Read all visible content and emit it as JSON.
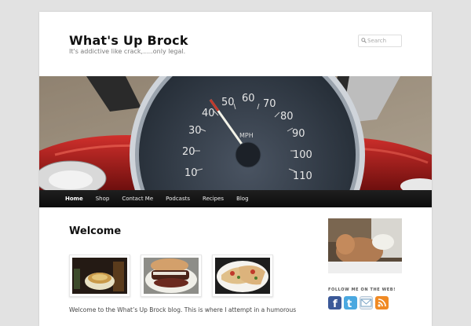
{
  "header": {
    "site_title": "What's Up Brock",
    "site_description": "It's addictive like crack,.....only legal."
  },
  "search": {
    "placeholder": "Search",
    "icon": "search-icon"
  },
  "banner": {
    "speedometer_numbers": [
      "10",
      "20",
      "30",
      "40",
      "50",
      "60",
      "70",
      "80",
      "90",
      "100",
      "110"
    ],
    "unit": "MPH"
  },
  "nav": {
    "items": [
      {
        "label": "Home",
        "active": true
      },
      {
        "label": "Shop"
      },
      {
        "label": "Contact Me"
      },
      {
        "label": "Podcasts"
      },
      {
        "label": "Recipes"
      },
      {
        "label": "Blog"
      }
    ]
  },
  "post": {
    "title": "Welcome",
    "intro": "Welcome to the What’s Up Brock blog. This is where I attempt in a humorous"
  },
  "sidebar": {
    "follow_title": "FOLLOW ME ON THE WEB!",
    "social": [
      {
        "name": "facebook-icon",
        "color": "#3b5998"
      },
      {
        "name": "twitter-icon",
        "color": "#4aa8e0"
      },
      {
        "name": "email-icon",
        "color": "#7aa4c6"
      },
      {
        "name": "rss-icon",
        "color": "#f08a24"
      }
    ]
  }
}
